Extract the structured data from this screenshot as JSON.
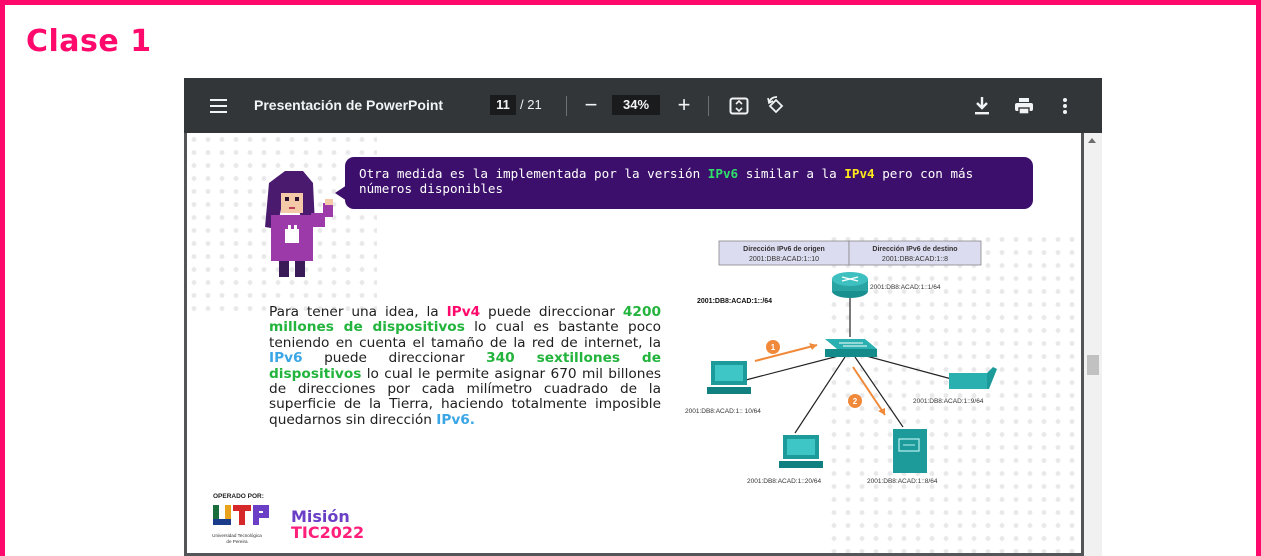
{
  "page": {
    "heading": "Clase 1",
    "accent": "#ff0a6c"
  },
  "toolbar": {
    "title": "Presentación de PowerPoint",
    "current_page": "11",
    "total_pages": "/ 21",
    "zoom": "34%",
    "zoom_out": "−",
    "zoom_in": "+",
    "icons": [
      "menu-icon",
      "fit-page-icon",
      "rotate-icon",
      "download-icon",
      "print-icon",
      "more-icon"
    ]
  },
  "slide": {
    "bubble": {
      "text_1": "Otra medida es la implementada por la versión ",
      "kw_1": "IPv6",
      "text_2": " similar a la ",
      "kw_2": "IPv4",
      "text_3": " pero con más",
      "text_4": "números disponibles"
    },
    "paragraph": {
      "p1": "Para tener una idea, la ",
      "h1": "IPv4",
      "p2": " puede direccionar ",
      "h2": "4200 millones de dispositivos",
      "p3": " lo cual es bastante poco teniendo en cuenta el tamaño de la red de internet, la ",
      "h3": "IPv6",
      "p4": " puede direccionar ",
      "h4": "340 sextillones de dispositivos",
      "p5": " lo cual le permite asignar 670 mil billones de direcciones por cada milímetro cuadrado de la superficie de la Tierra, haciendo totalmente imposible quedarnos sin dirección ",
      "h5": "IPv6."
    },
    "diagram": {
      "header_src_title": "Dirección IPv6 de origen",
      "header_src_value": "2001:DB8:ACAD:1::10",
      "header_dst_title": "Dirección IPv6 de destino",
      "header_dst_value": "2001:DB8:ACAD:1::8",
      "network": "2001:DB8:ACAD:1::/64",
      "router": "2001:DB8:ACAD:1::1/64",
      "pc_left": "2001:DB8:ACAD:1:: 10/64",
      "printer": "2001:DB8:ACAD:1::9/64",
      "pc_bottom": "2001:DB8:ACAD:1::20/64",
      "server": "2001:DB8:ACAD:1::8/64",
      "step_1": "1",
      "step_2": "2"
    },
    "logos": {
      "operated_by": "OPERADO POR:",
      "utp": "UTP",
      "utp_name": "Universidad Tecnológica de Pereira",
      "mision": "Misión",
      "tic": "TIC2022"
    }
  }
}
